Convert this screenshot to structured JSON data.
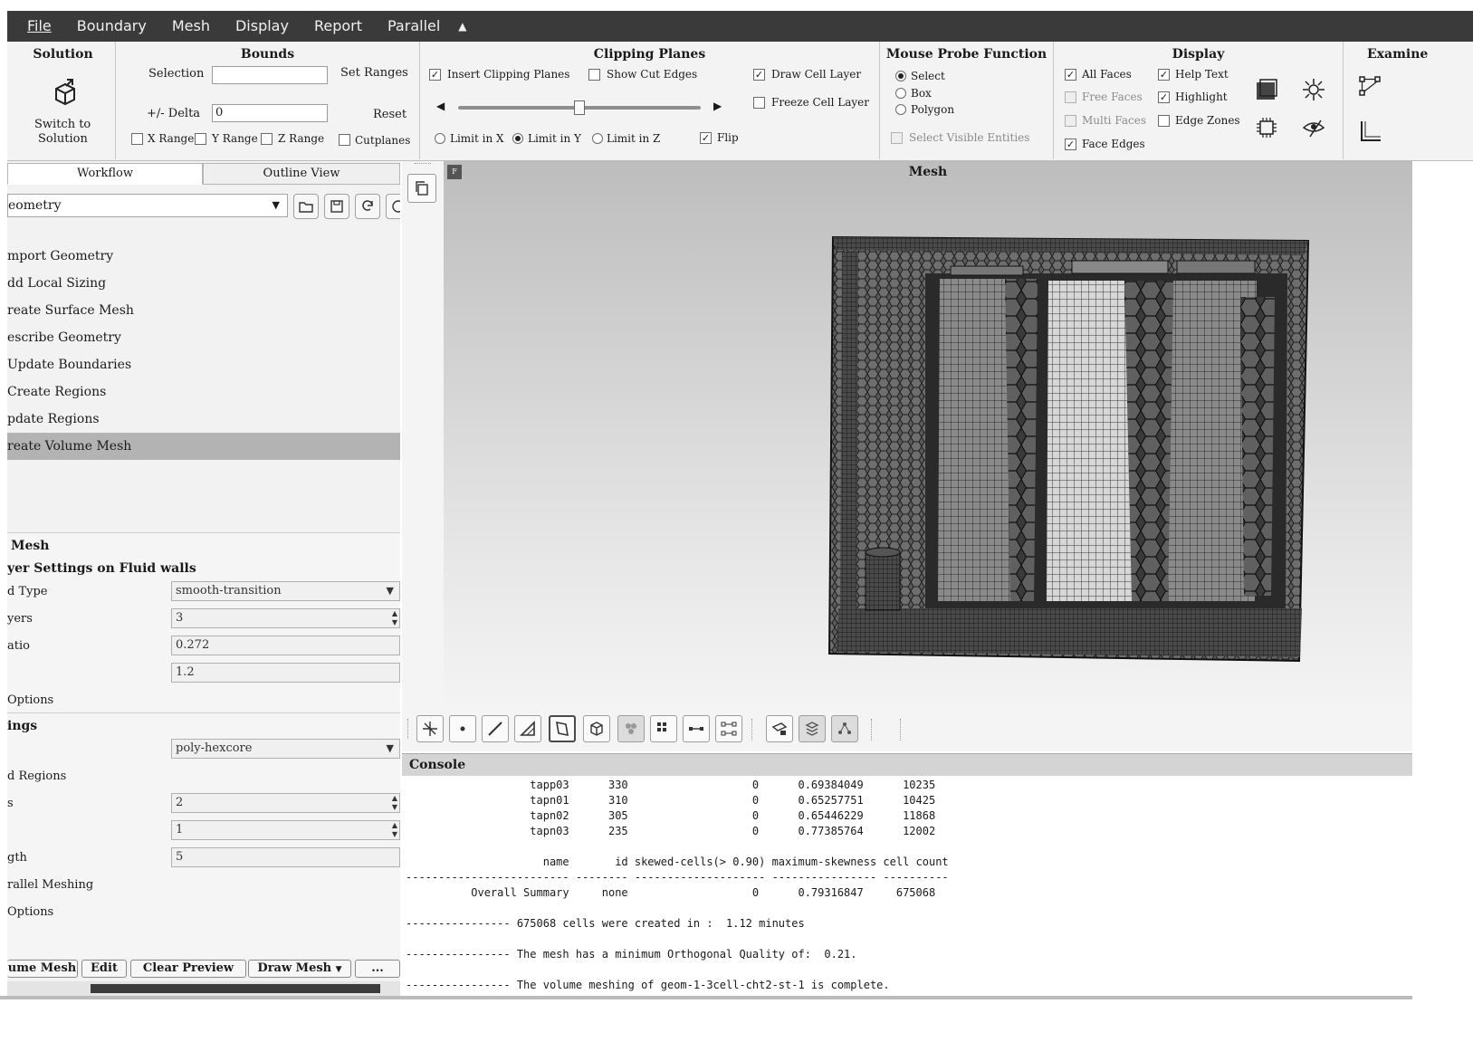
{
  "menubar": {
    "items": [
      "File",
      "Boundary",
      "Mesh",
      "Display",
      "Report",
      "Parallel"
    ],
    "collapse_icon": "caret-up-icon"
  },
  "ribbon": {
    "solution": {
      "title": "Solution",
      "switch_label_1": "Switch to",
      "switch_label_2": "Solution"
    },
    "bounds": {
      "title": "Bounds",
      "selection_label": "Selection",
      "set_ranges": "Set Ranges",
      "delta_label": "+/- Delta",
      "delta_value": "0",
      "reset": "Reset",
      "x_range": "X Range",
      "y_range": "Y Range",
      "z_range": "Z Range",
      "cutplanes": "Cutplanes"
    },
    "clipping": {
      "title": "Clipping Planes",
      "insert": "Insert Clipping Planes",
      "show_cut_edges": "Show Cut Edges",
      "draw_cell_layer": "Draw Cell Layer",
      "freeze_cell_layer": "Freeze Cell Layer",
      "limit_x": "Limit in X",
      "limit_y": "Limit in Y",
      "limit_z": "Limit in Z",
      "flip": "Flip",
      "slider_value": 0.5
    },
    "probe": {
      "title": "Mouse Probe Function",
      "select": "Select",
      "box": "Box",
      "polygon": "Polygon",
      "select_visible": "Select Visible Entities"
    },
    "display": {
      "title": "Display",
      "all_faces": "All Faces",
      "free_faces": "Free Faces",
      "multi_faces": "Multi Faces",
      "face_edges": "Face Edges",
      "help_text": "Help Text",
      "highlight": "Highlight",
      "edge_zones": "Edge Zones"
    },
    "examine": {
      "title": "Examine"
    }
  },
  "left": {
    "tabs": [
      "Workflow",
      "Outline View"
    ],
    "workflow_select": "eometry",
    "steps": [
      "mport Geometry",
      "dd Local Sizing",
      "reate Surface Mesh",
      "escribe Geometry",
      " Update Boundaries",
      " Create Regions",
      "pdate Regions",
      "reate Volume Mesh"
    ],
    "props": {
      "section1": "Mesh",
      "section2": "yer Settings on Fluid walls",
      "rows": [
        {
          "label": "d Type",
          "value": "smooth-transition"
        },
        {
          "label": "yers",
          "value": "3"
        },
        {
          "label": "atio",
          "value": "0.272"
        },
        {
          "label": "",
          "value": "1.2"
        }
      ],
      "options1": "Options",
      "section3": "ings",
      "fill_value": "poly-hexcore",
      "regions_label": "d Regions",
      "rows2": [
        {
          "label": "s",
          "value": "2"
        },
        {
          "label": "",
          "value": "1"
        },
        {
          "label": "gth",
          "value": "5"
        }
      ],
      "parallel_label": "rallel Meshing",
      "options2": "Options"
    },
    "buttons": [
      "ume Mesh",
      "Edit",
      "Clear Preview",
      "Draw Mesh",
      "..."
    ]
  },
  "viewport": {
    "title": "Mesh",
    "badge": "F"
  },
  "console": {
    "title": "Console",
    "lines": [
      "                   tapp03      330                   0      0.69384049      10235",
      "                   tapn01      310                   0      0.65257751      10425",
      "                   tapn02      305                   0      0.65446229      11868",
      "                   tapn03      235                   0      0.77385764      12002",
      "",
      "                     name       id skewed-cells(> 0.90) maximum-skewness cell count",
      "------------------------- -------- -------------------- ---------------- ----------",
      "          Overall Summary     none                   0      0.79316847     675068",
      "",
      "---------------- 675068 cells were created in :  1.12 minutes",
      "",
      "---------------- The mesh has a minimum Orthogonal Quality of:  0.21.",
      "",
      "---------------- The volume meshing of geom-1-3cell-cht2-st-1 is complete."
    ]
  },
  "colors": {
    "menubar": "#3a3a3a",
    "selected_step": "#b3b3b3",
    "console_header": "#d4d4d4"
  }
}
